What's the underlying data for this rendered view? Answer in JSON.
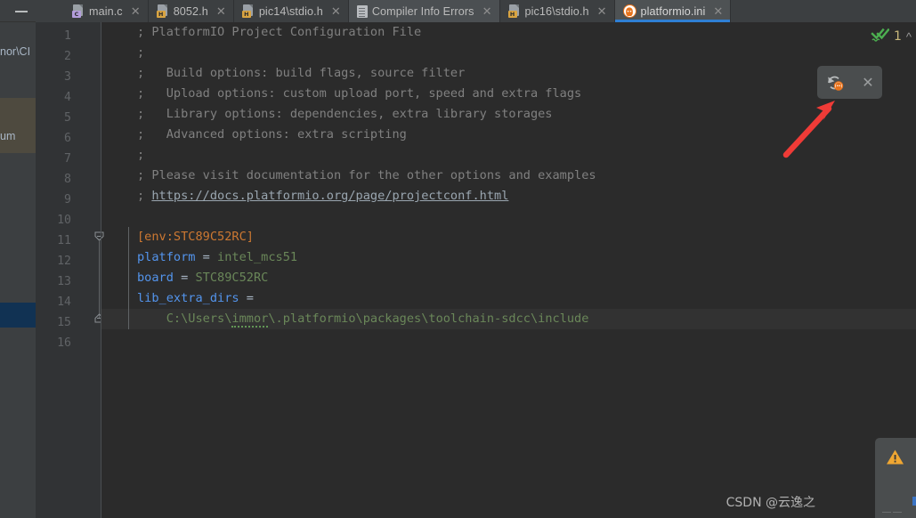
{
  "window": {
    "minimize_label": "—"
  },
  "tabs": [
    {
      "label": "main.c",
      "icon": "c-file-icon",
      "badge": "C",
      "state": "inactive",
      "close": "✕"
    },
    {
      "label": "8052.h",
      "icon": "h-file-icon",
      "badge": "H",
      "state": "inactive",
      "close": "✕"
    },
    {
      "label": "pic14\\stdio.h",
      "icon": "h-file-icon",
      "badge": "H",
      "state": "inactive",
      "close": "✕"
    },
    {
      "label": "Compiler Info Errors",
      "icon": "document-icon",
      "badge": "",
      "state": "hover",
      "close": "✕"
    },
    {
      "label": "pic16\\stdio.h",
      "icon": "h-file-icon",
      "badge": "H",
      "state": "inactive",
      "close": "✕"
    },
    {
      "label": "platformio.ini",
      "icon": "platformio-icon",
      "badge": "",
      "state": "active",
      "close": "✕"
    }
  ],
  "sidebar": {
    "path_fragment": "nor\\CI",
    "selected_fragment": "um"
  },
  "editor": {
    "line_numbers": [
      "1",
      "2",
      "3",
      "4",
      "5",
      "6",
      "7",
      "8",
      "9",
      "10",
      "11",
      "12",
      "13",
      "14",
      "15",
      "16"
    ],
    "current_line": 15,
    "lines": [
      {
        "n": 1,
        "segments": [
          {
            "t": "; PlatformIO Project Configuration File",
            "c": "cmt"
          }
        ]
      },
      {
        "n": 2,
        "segments": [
          {
            "t": ";",
            "c": "cmt"
          }
        ]
      },
      {
        "n": 3,
        "segments": [
          {
            "t": ";   Build options: build flags, source filter",
            "c": "cmt"
          }
        ]
      },
      {
        "n": 4,
        "segments": [
          {
            "t": ";   Upload options: custom upload port, speed and extra flags",
            "c": "cmt"
          }
        ]
      },
      {
        "n": 5,
        "segments": [
          {
            "t": ";   Library options: dependencies, extra library storages",
            "c": "cmt"
          }
        ]
      },
      {
        "n": 6,
        "segments": [
          {
            "t": ";   Advanced options: extra scripting",
            "c": "cmt"
          }
        ]
      },
      {
        "n": 7,
        "segments": [
          {
            "t": ";",
            "c": "cmt"
          }
        ]
      },
      {
        "n": 8,
        "segments": [
          {
            "t": "; Please visit documentation for the other options and examples",
            "c": "cmt"
          }
        ]
      },
      {
        "n": 9,
        "segments": [
          {
            "t": "; ",
            "c": "cmt"
          },
          {
            "t": "https://docs.platformio.org/page/projectconf.html",
            "c": "lnk"
          }
        ]
      },
      {
        "n": 10,
        "segments": []
      },
      {
        "n": 11,
        "segments": [
          {
            "t": "[env:STC89C52RC]",
            "c": "sect"
          }
        ]
      },
      {
        "n": 12,
        "segments": [
          {
            "t": "platform",
            "c": "keyb"
          },
          {
            "t": " = ",
            "c": "eq"
          },
          {
            "t": "intel_mcs51",
            "c": "val"
          }
        ]
      },
      {
        "n": 13,
        "segments": [
          {
            "t": "board",
            "c": "keyb"
          },
          {
            "t": " = ",
            "c": "eq"
          },
          {
            "t": "STC89C52RC",
            "c": "val"
          }
        ]
      },
      {
        "n": 14,
        "segments": [
          {
            "t": "lib_extra_dirs",
            "c": "keyb"
          },
          {
            "t": " =",
            "c": "eq"
          }
        ]
      },
      {
        "n": 15,
        "segments": [
          {
            "t": "    C:\\Users\\",
            "c": "val"
          },
          {
            "t": "immor",
            "c": "val squig"
          },
          {
            "t": "\\.platformio\\packages\\toolchain-sdcc\\include",
            "c": "val"
          }
        ]
      },
      {
        "n": 16,
        "segments": []
      }
    ]
  },
  "inspection": {
    "status_icon": "double-check-icon",
    "count": "1",
    "chevron": "^"
  },
  "pio_toolbar": {
    "refresh_icon": "refresh-platformio-icon",
    "close_icon": "✕"
  },
  "annotation": {
    "arrow": "red-arrow-up-right"
  },
  "warning_panel": {
    "icon": "warning-triangle-icon"
  },
  "watermark": {
    "text": "CSDN @云逸之"
  },
  "colors": {
    "accent_blue": "#2f7fd4",
    "section": "#cc7832",
    "string_green": "#6a8759",
    "comment_gray": "#808080",
    "keyword_blue": "#5394ec",
    "warning_orange": "#f0a732",
    "ok_green": "#5ba85b",
    "arrow_red": "#ef3b37",
    "editor_bg": "#2b2b2b",
    "gutter_bg": "#313335",
    "chrome_bg": "#3c3f41"
  }
}
